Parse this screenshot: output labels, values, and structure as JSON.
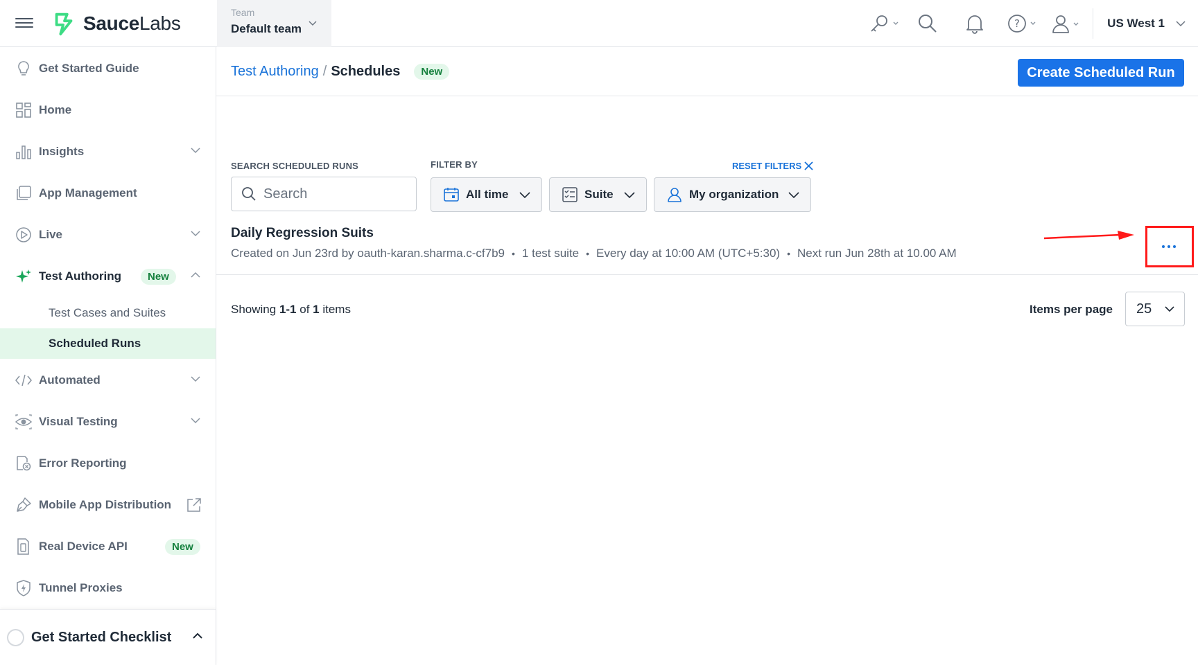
{
  "header": {
    "logo": {
      "brand_bold": "Sauce",
      "brand_light": "Labs",
      "brand_color": "#3ddc84"
    },
    "team": {
      "label": "Team",
      "value": "Default team"
    },
    "region": "US West 1"
  },
  "sidebar": {
    "items": [
      {
        "label": "Get Started Guide",
        "icon": "lightbulb-icon"
      },
      {
        "label": "Home",
        "icon": "grid-icon"
      },
      {
        "label": "Insights",
        "icon": "bar-chart-icon"
      },
      {
        "label": "App Management",
        "icon": "app-stack-icon"
      },
      {
        "label": "Live",
        "icon": "play-circle-icon"
      },
      {
        "label": "Test Authoring",
        "icon": "sparkle-icon",
        "badge": "New"
      },
      {
        "label": "Automated",
        "icon": "code-icon"
      },
      {
        "label": "Visual Testing",
        "icon": "eye-icon"
      },
      {
        "label": "Error Reporting",
        "icon": "error-doc-icon"
      },
      {
        "label": "Mobile App Distribution",
        "icon": "pen-tool-icon"
      },
      {
        "label": "Real Device API",
        "icon": "device-doc-icon",
        "badge": "New"
      },
      {
        "label": "Tunnel Proxies",
        "icon": "shield-bolt-icon"
      }
    ],
    "sub_items": [
      {
        "label": "Test Cases and Suites"
      },
      {
        "label": "Scheduled Runs"
      }
    ],
    "checklist": "Get Started Checklist"
  },
  "main": {
    "breadcrumb": {
      "parent": "Test Authoring",
      "separator": "/",
      "current": "Schedules",
      "badge": "New"
    },
    "create_button": "Create Scheduled Run",
    "filters": {
      "search_label": "SEARCH SCHEDULED RUNS",
      "search_placeholder": "Search",
      "filter_label": "FILTER BY",
      "reset_label": "RESET FILTERS",
      "time": "All time",
      "suite": "Suite",
      "org": "My organization"
    },
    "runs": [
      {
        "title": "Daily Regression Suits",
        "created": "Created on Jun 23rd by oauth-karan.sharma.c-cf7b9",
        "suites": "1 test suite",
        "schedule": "Every day at 10:00 AM (UTC+5:30)",
        "next_run": "Next run Jun 28th at 10.00 AM"
      }
    ],
    "pagination": {
      "showing_prefix": "Showing ",
      "range": "1-1",
      "of": " of ",
      "total": "1",
      "suffix": " items",
      "ipp_label": "Items per page",
      "ipp_value": "25"
    }
  },
  "colors": {
    "accent": "#1a73e8",
    "highlight": "#ff1a1a",
    "badge_bg": "#e3f7ea",
    "badge_text": "#15803d"
  }
}
